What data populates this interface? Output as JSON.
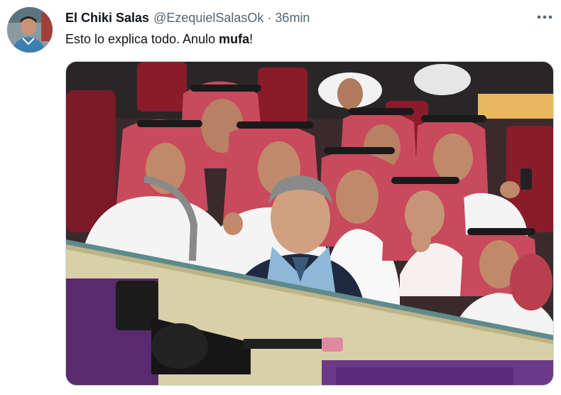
{
  "tweet": {
    "author": {
      "display_name": "El Chiki Salas",
      "handle": "@EzequielSalasOk",
      "avatar_icon": "user-avatar-photo"
    },
    "separator": "·",
    "time": "36min",
    "more_icon": "more-horizontal-icon",
    "text": {
      "before": "Esto lo explica todo. Anulo ",
      "bold": "mufa",
      "after": "!"
    },
    "media": {
      "type": "photo"
    }
  },
  "colors": {
    "text_primary": "#0f1419",
    "text_secondary": "#536471",
    "border": "#cfd9de",
    "background": "#ffffff"
  }
}
